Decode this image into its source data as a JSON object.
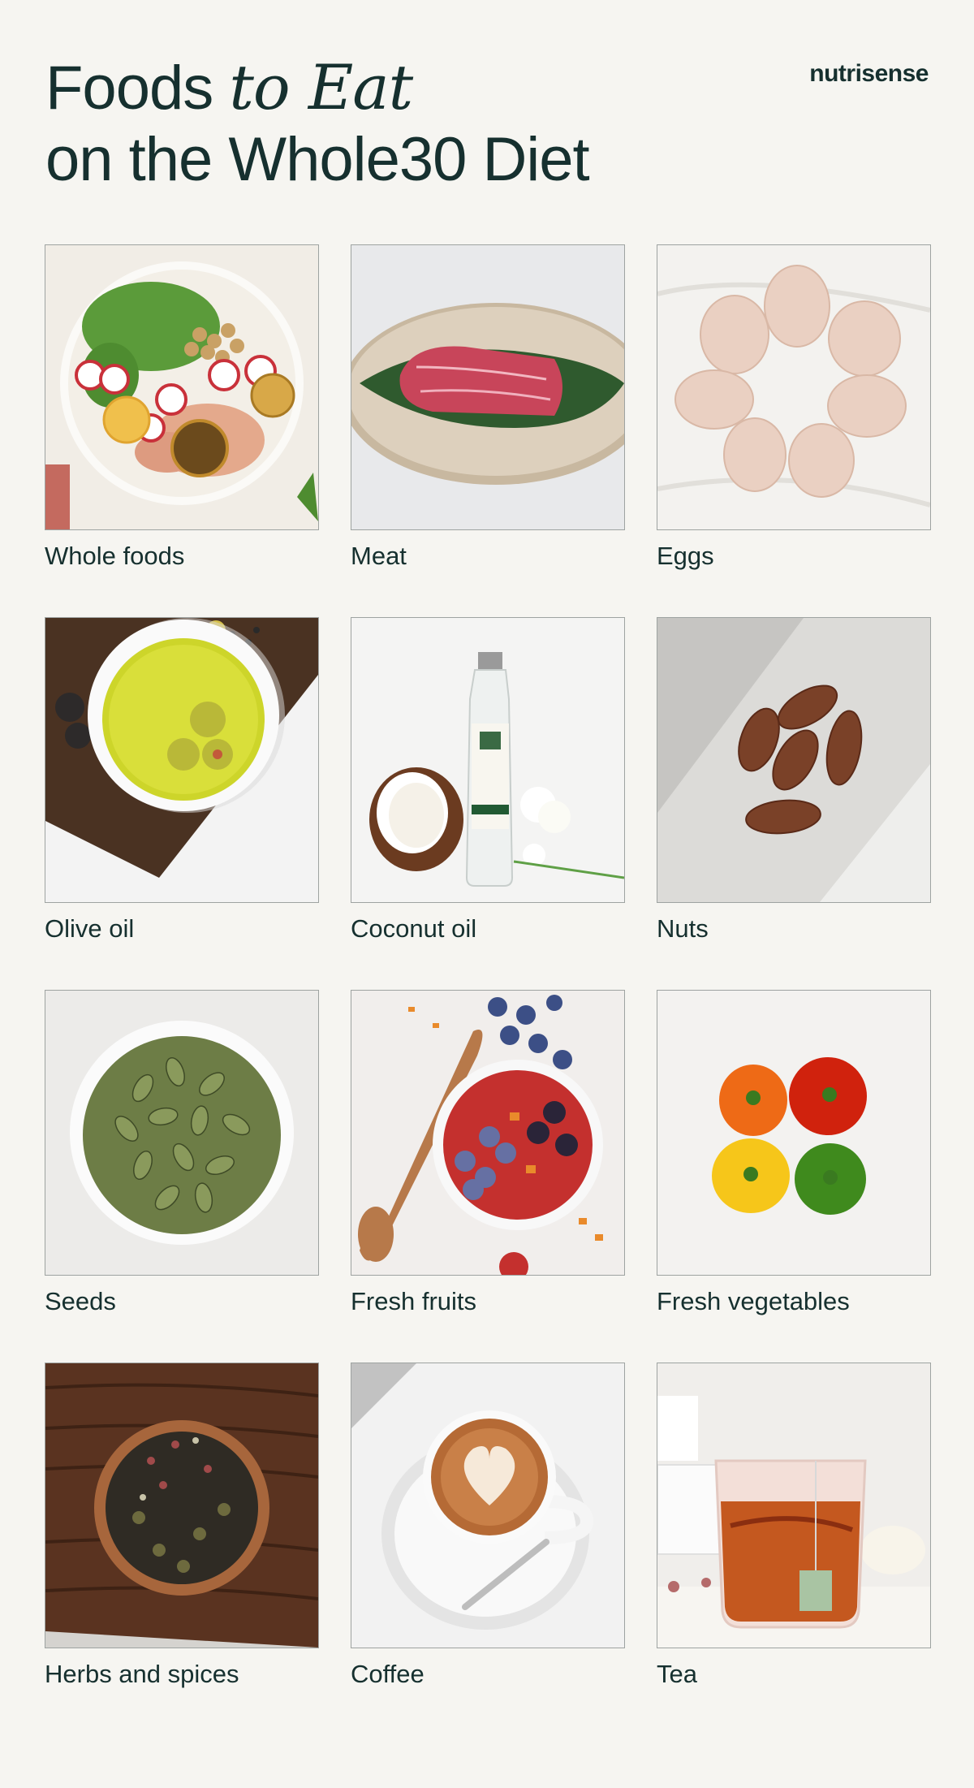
{
  "header": {
    "title_line1_a": "Foods",
    "title_line1_b": "to Eat",
    "title_line2": "on the Whole30 Diet",
    "brand": "nutrisense"
  },
  "foods": [
    {
      "label": "Whole foods",
      "icon": "salad-bowl-photo"
    },
    {
      "label": "Meat",
      "icon": "raw-steak-photo"
    },
    {
      "label": "Eggs",
      "icon": "eggs-photo"
    },
    {
      "label": "Olive oil",
      "icon": "olive-oil-bowl-photo"
    },
    {
      "label": "Coconut oil",
      "icon": "coconut-oil-bottle-photo"
    },
    {
      "label": "Nuts",
      "icon": "almonds-photo"
    },
    {
      "label": "Seeds",
      "icon": "pumpkin-seeds-photo"
    },
    {
      "label": "Fresh fruits",
      "icon": "berry-bowl-photo"
    },
    {
      "label": "Fresh vegetables",
      "icon": "bell-peppers-photo"
    },
    {
      "label": "Herbs and spices",
      "icon": "herb-bowl-photo"
    },
    {
      "label": "Coffee",
      "icon": "latte-cup-photo"
    },
    {
      "label": "Tea",
      "icon": "tea-glass-photo"
    }
  ]
}
